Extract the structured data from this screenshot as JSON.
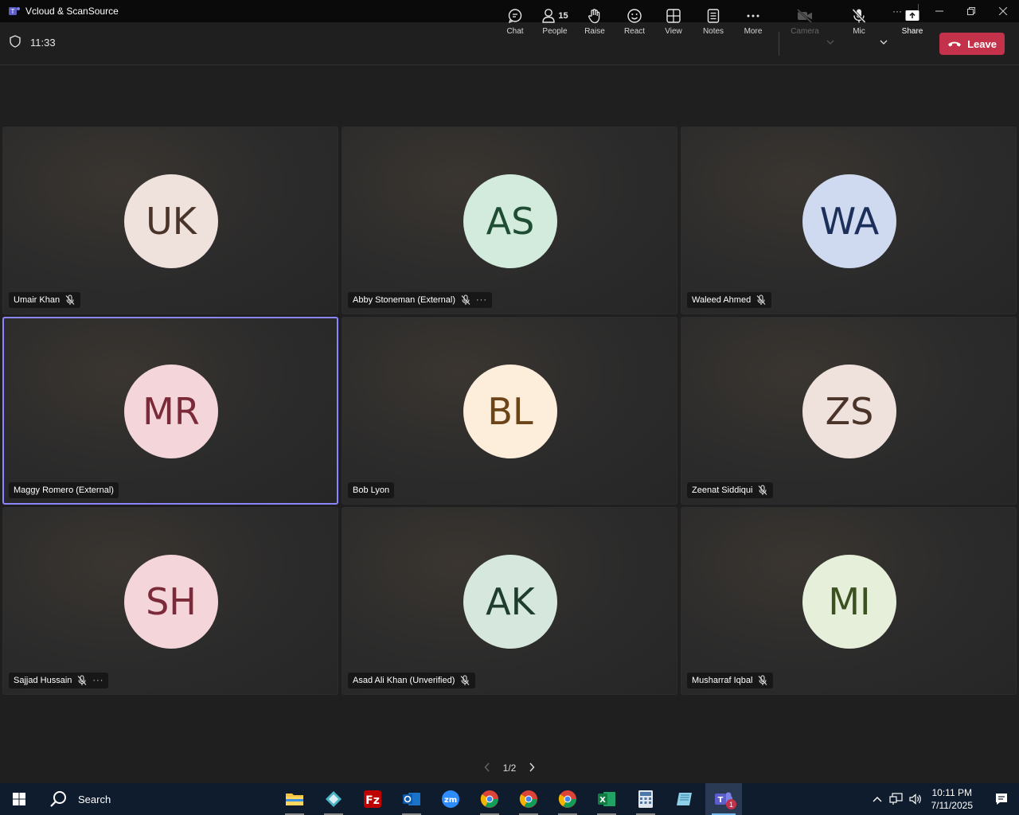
{
  "window": {
    "title": "Vcloud & ScanSource",
    "more_label": "···"
  },
  "meeting": {
    "timer": "11:33",
    "people_count": "15",
    "tools": {
      "chat": "Chat",
      "people": "People",
      "raise": "Raise",
      "react": "React",
      "view": "View",
      "notes": "Notes",
      "more": "More",
      "camera": "Camera",
      "mic": "Mic",
      "share": "Share"
    },
    "leave_label": "Leave"
  },
  "participants": [
    {
      "initials": "UK",
      "name": "Umair Khan",
      "muted": true,
      "more": false,
      "bg": "#efe2dc",
      "fg": "#4a3328"
    },
    {
      "initials": "AS",
      "name": "Abby Stoneman (External)",
      "muted": true,
      "more": true,
      "bg": "#d3ebdc",
      "fg": "#1f4d33"
    },
    {
      "initials": "WA",
      "name": "Waleed Ahmed",
      "muted": true,
      "more": false,
      "bg": "#cfdaf0",
      "fg": "#1c2f5a"
    },
    {
      "initials": "MR",
      "name": "Maggy Romero (External)",
      "muted": false,
      "more": false,
      "bg": "#f4d6da",
      "fg": "#7a2a38"
    },
    {
      "initials": "BL",
      "name": "Bob Lyon",
      "muted": false,
      "more": false,
      "bg": "#fdeedb",
      "fg": "#6b4418"
    },
    {
      "initials": "ZS",
      "name": "Zeenat Siddiqui",
      "muted": true,
      "more": false,
      "bg": "#efe2dc",
      "fg": "#4a3328"
    },
    {
      "initials": "SH",
      "name": "Sajjad Hussain",
      "muted": true,
      "more": true,
      "bg": "#f4d6da",
      "fg": "#7a2a38"
    },
    {
      "initials": "AK",
      "name": "Asad Ali Khan (Unverified)",
      "muted": true,
      "more": false,
      "bg": "#d6e8dd",
      "fg": "#1f3d2c"
    },
    {
      "initials": "MI",
      "name": "Musharraf Iqbal",
      "muted": true,
      "more": false,
      "bg": "#e6efd9",
      "fg": "#3b5220"
    }
  ],
  "pager": {
    "label": "1/2"
  },
  "taskbar": {
    "search_label": "Search",
    "teams_badge": "1",
    "time": "10:11 PM",
    "date": "7/11/2025",
    "apps": [
      "file-explorer",
      "app-diamond",
      "filezilla",
      "outlook",
      "zoom",
      "chrome",
      "chrome",
      "chrome",
      "excel",
      "calculator",
      "notepad",
      "teams"
    ]
  },
  "colors": {
    "accent": "#8b85ff",
    "leave": "#c4314b",
    "taskbar": "#0f1c2e"
  }
}
